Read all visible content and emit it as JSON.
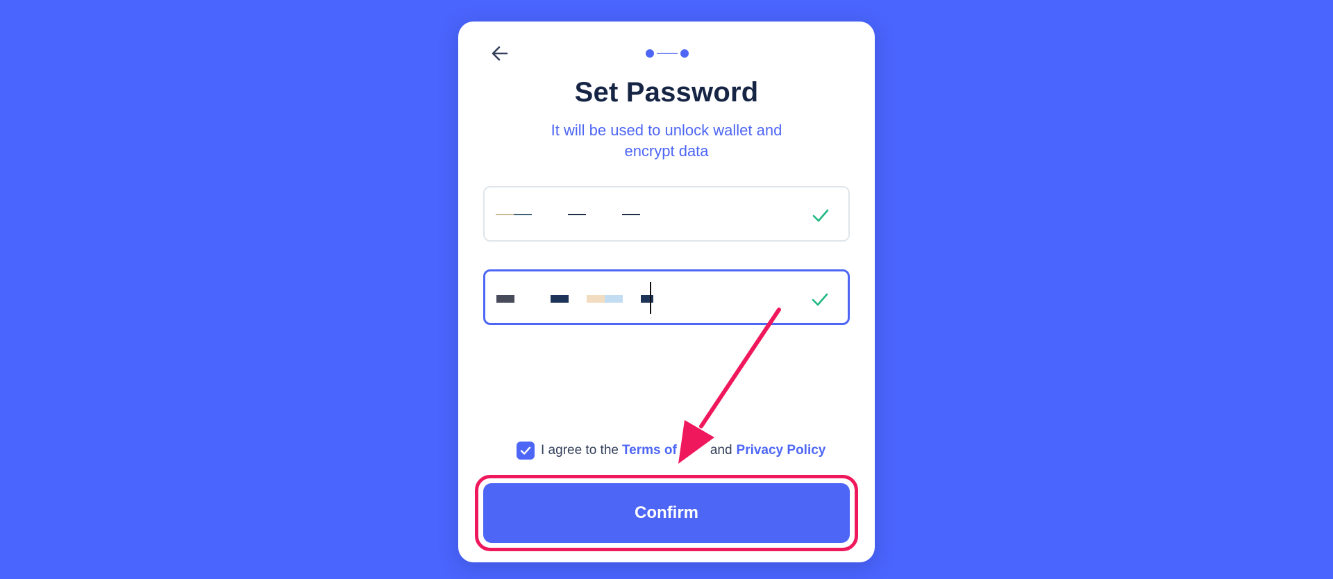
{
  "colors": {
    "background": "#4a65fd",
    "accent": "#4d66f5",
    "success": "#1fb880",
    "title": "#172545",
    "annotation": "#f0185c"
  },
  "header": {
    "back_icon": "arrow-left-icon",
    "step_total": 2
  },
  "content": {
    "title": "Set Password",
    "subtitle": "It will be used to unlock wallet and encrypt data"
  },
  "form": {
    "password": {
      "icon": "check-icon"
    },
    "confirm_password": {
      "icon": "check-icon",
      "focused": true
    }
  },
  "agreement": {
    "checked": true,
    "prefix": "I agree to the",
    "terms_visible": "Terms of",
    "conjunction": "and",
    "privacy": "Privacy Policy"
  },
  "actions": {
    "confirm_label": "Confirm"
  },
  "annotation": {
    "arrow_icon": "pointer-arrow-icon",
    "highlight_target": "confirm-button"
  }
}
